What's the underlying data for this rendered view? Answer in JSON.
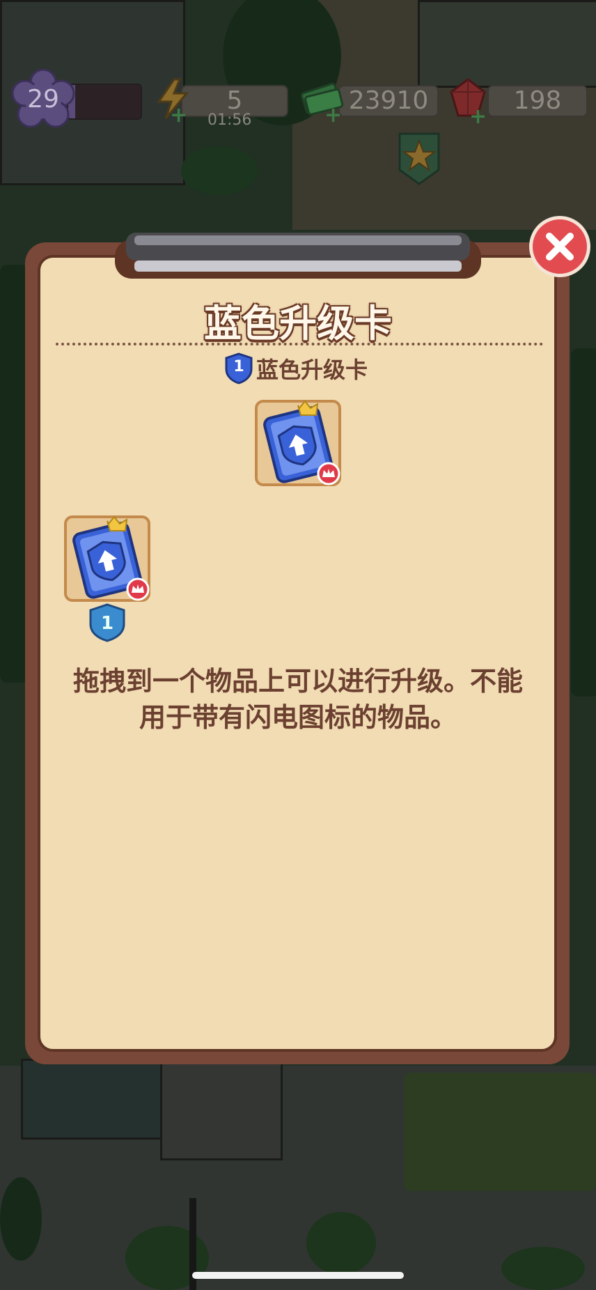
{
  "hud": {
    "level": "29",
    "level_progress": 0.1,
    "energy": "5",
    "energy_timer": "01:56",
    "cash": "23910",
    "gems": "198"
  },
  "dialog": {
    "title": "蓝色升级卡",
    "item_tier": "1",
    "item_name": "蓝色升级卡",
    "merged_tier": "1",
    "description_line1": "拖拽到一个物品上可以进行升级。不能",
    "description_line2": "用于带有闪电图标的物品。"
  },
  "colors": {
    "panel": "#f2dcb4",
    "frame": "#7a4838",
    "close": "#e24b4f",
    "card_blue": "#3a62d8",
    "crown": "#f2c640"
  },
  "icons": [
    "level-flower-icon",
    "energy-bolt-icon",
    "cash-stack-icon",
    "gem-icon",
    "star-icon",
    "close-icon",
    "tier-shield-icon",
    "upgrade-card-icon"
  ]
}
